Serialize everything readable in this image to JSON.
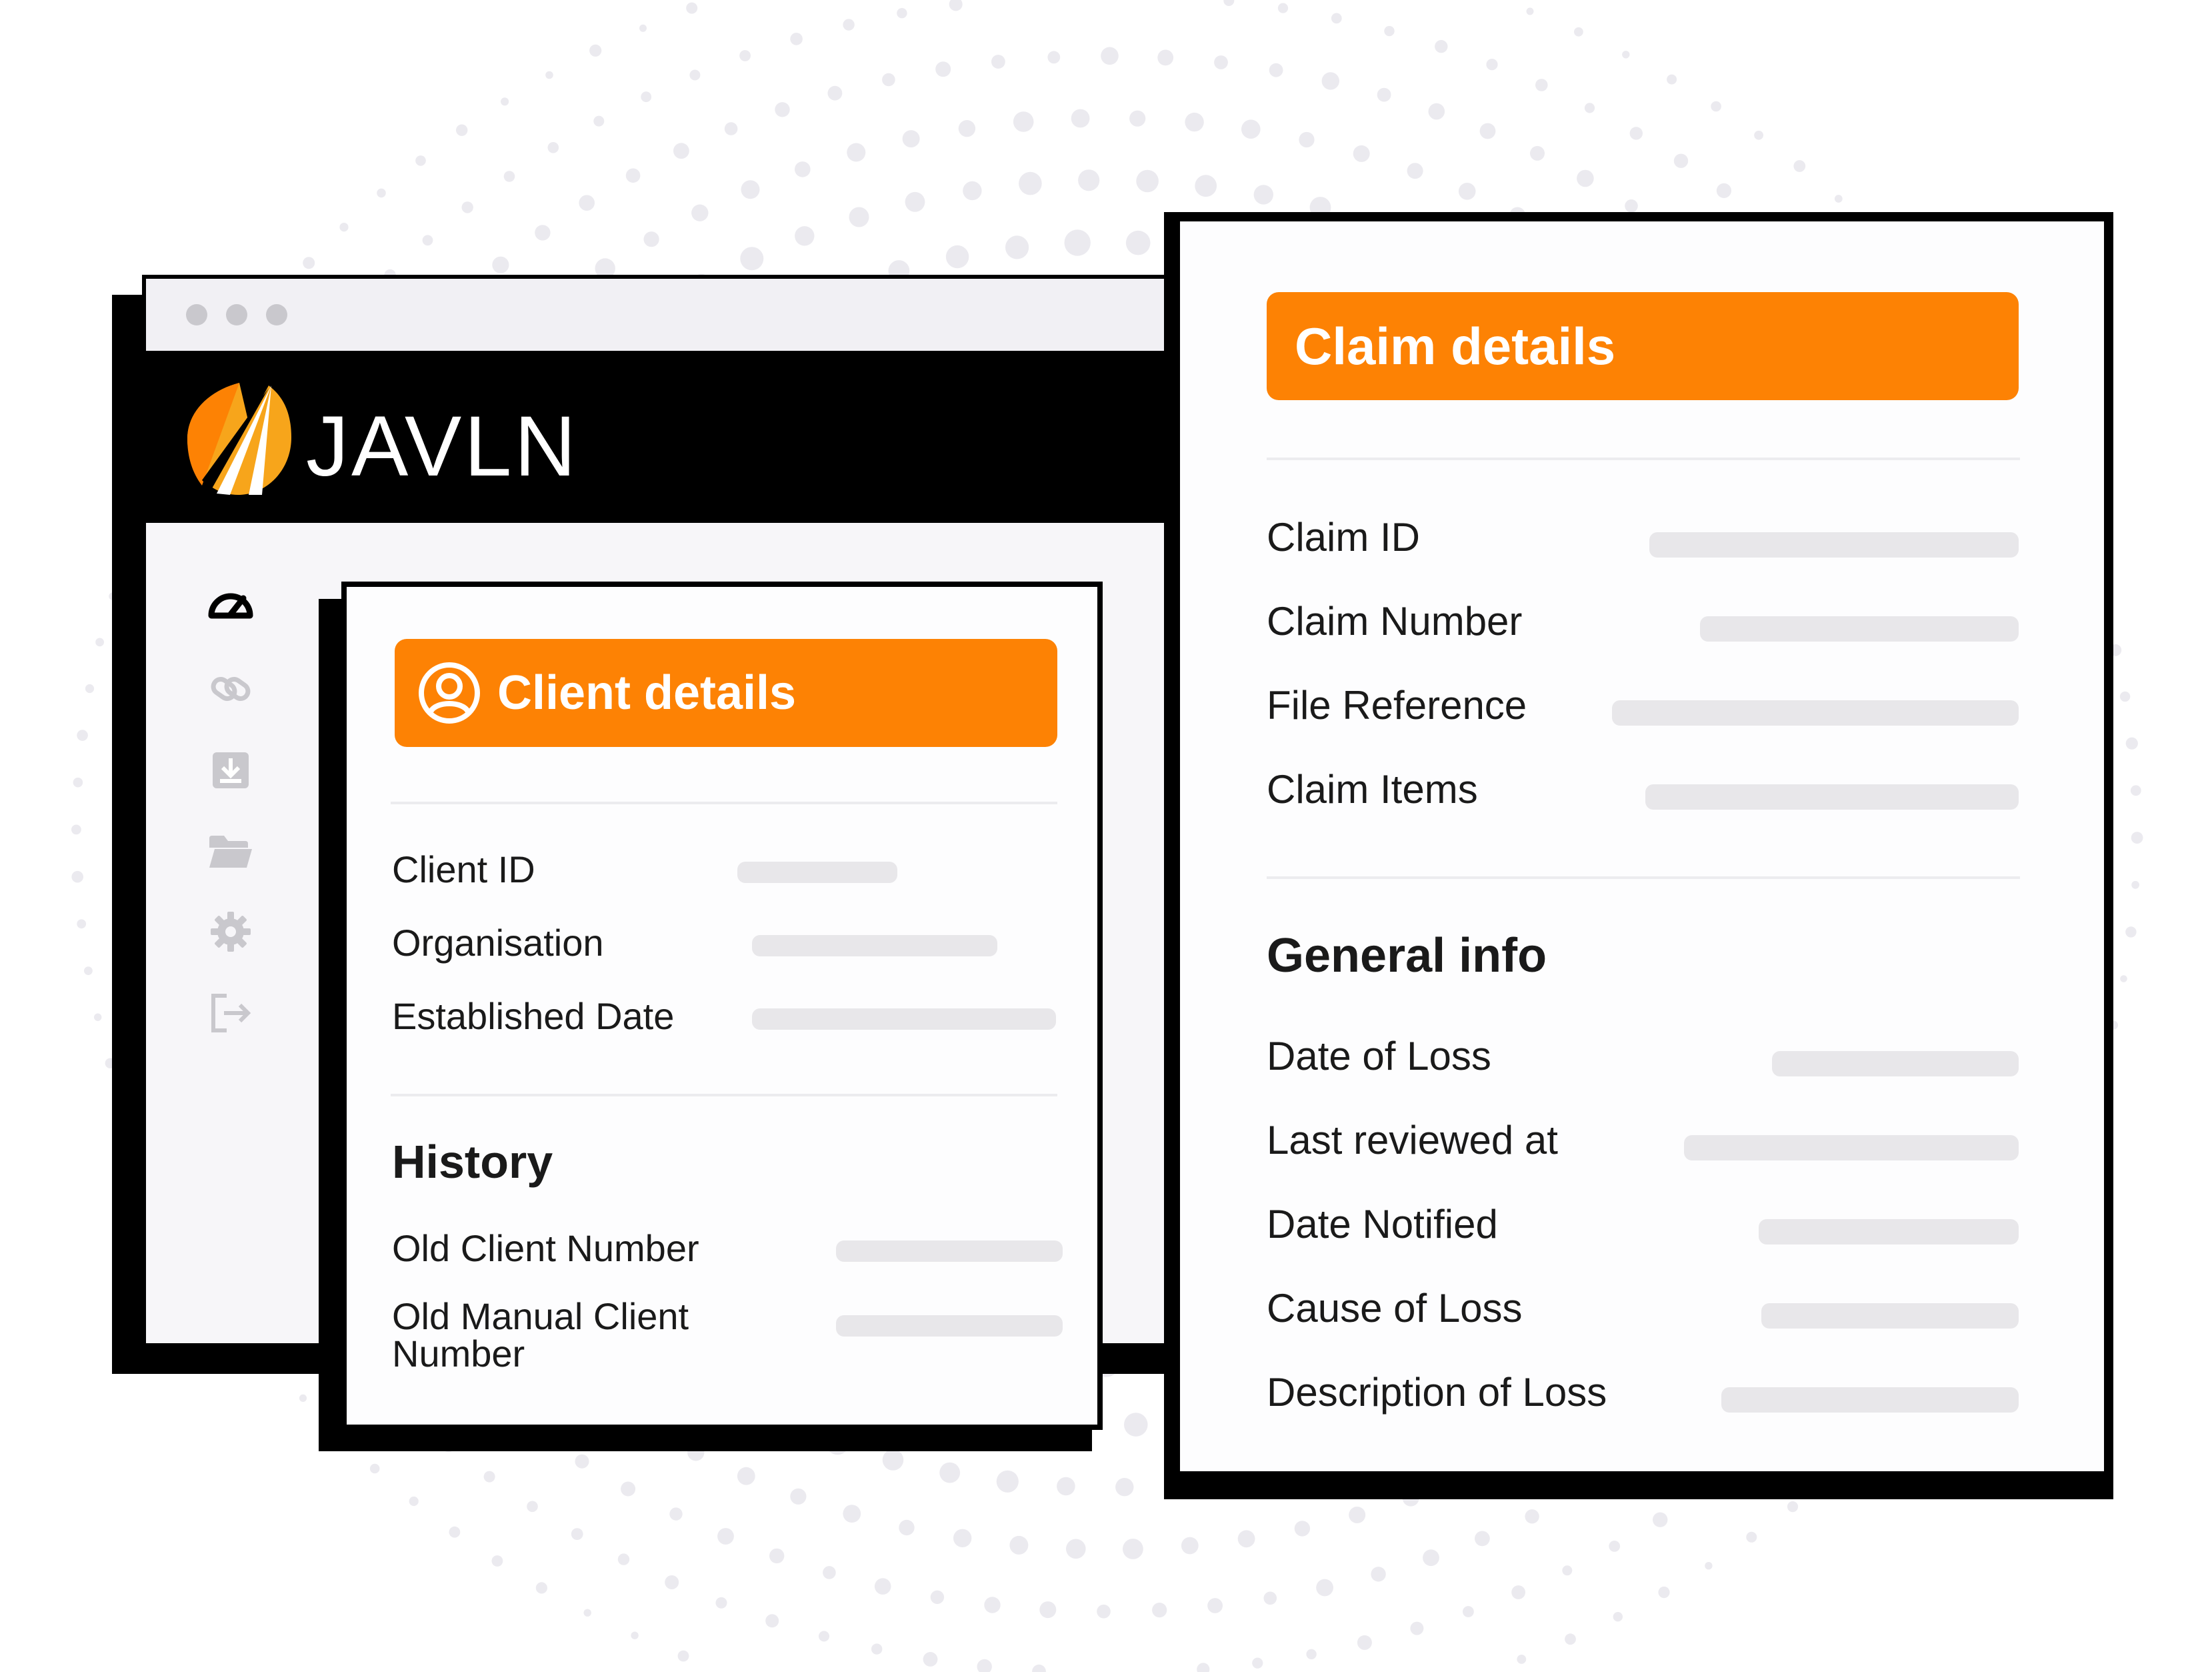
{
  "app": {
    "brand": "JAVLN",
    "window_dots": [
      "#c9c8cd",
      "#c9c8cd",
      "#c9c8cd"
    ],
    "accent_color": "#fd8204",
    "logo_colors": [
      "#f7a51b",
      "#fd8204",
      "#ffffff",
      "#000000"
    ]
  },
  "sidebar": {
    "icons": [
      {
        "name": "dashboard-gauge-icon",
        "active": true
      },
      {
        "name": "link-icon",
        "active": false
      },
      {
        "name": "download-icon",
        "active": false
      },
      {
        "name": "folder-icon",
        "active": false
      },
      {
        "name": "gear-icon",
        "active": false
      },
      {
        "name": "logout-icon",
        "active": false
      }
    ]
  },
  "client_card": {
    "header_icon": "user-circle-icon",
    "title": "Client details",
    "fields": [
      {
        "label": "Client ID"
      },
      {
        "label": "Organisation"
      },
      {
        "label": "Established Date"
      }
    ],
    "history_title": "History",
    "history_fields": [
      {
        "label": "Old Client  Number"
      },
      {
        "label": "Old Manual Client",
        "label_line2": "Number"
      }
    ]
  },
  "claim_card": {
    "title": "Claim details",
    "fields": [
      {
        "label": "Claim ID"
      },
      {
        "label": "Claim Number"
      },
      {
        "label": "File Reference"
      },
      {
        "label": "Claim Items"
      }
    ],
    "general_title": "General info",
    "general_fields": [
      {
        "label": "Date of Loss"
      },
      {
        "label": "Last reviewed at"
      },
      {
        "label": "Date Notified"
      },
      {
        "label": "Cause of Loss"
      },
      {
        "label": "Description of Loss"
      }
    ]
  }
}
